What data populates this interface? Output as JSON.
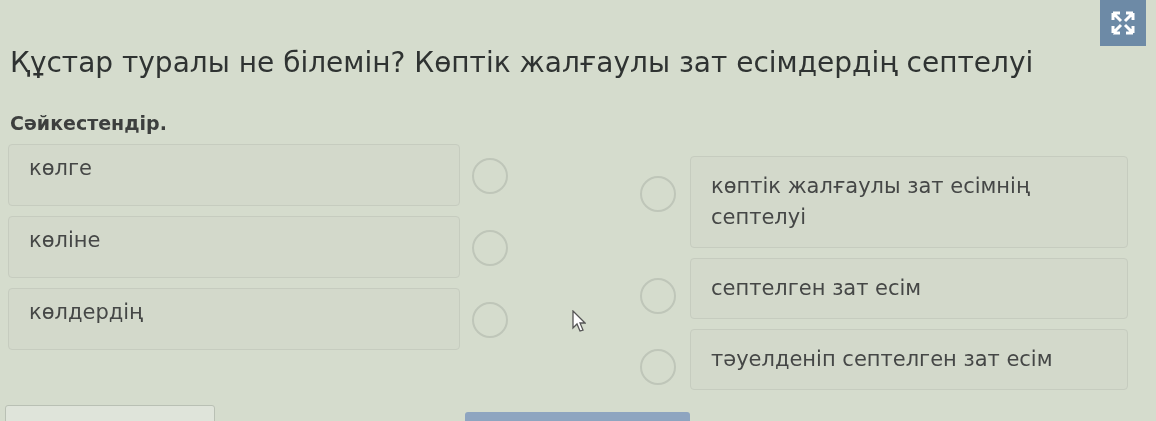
{
  "title": "Құстар туралы не білемін? Көптік жалғаулы зат есімдердің септелуі",
  "instruction": "Сәйкестендір.",
  "left_items": [
    {
      "text": "көлге",
      "selected": false
    },
    {
      "text": "көліне",
      "selected": false
    },
    {
      "text": "көлдердің",
      "selected": false
    }
  ],
  "right_items": [
    {
      "text": "көптік жалғаулы зат есімнің септелуі",
      "selected": false
    },
    {
      "text": "септелген зат есім",
      "selected": false
    },
    {
      "text": "тәуелденіп септелген зат есім",
      "selected": false
    }
  ]
}
